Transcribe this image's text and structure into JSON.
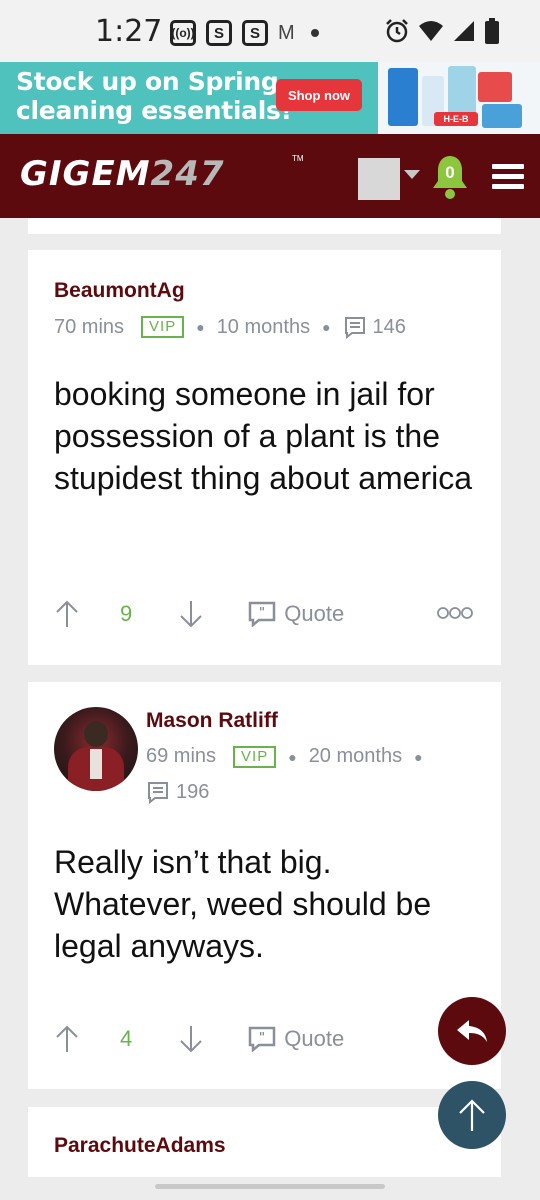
{
  "status_bar": {
    "time": "1:27",
    "icons": [
      "nfc-icon",
      "s-app-icon",
      "s-app-icon",
      "gmail-icon",
      "dot-icon",
      "alarm-icon",
      "wifi-icon",
      "signal-icon",
      "battery-icon"
    ],
    "s1": "S",
    "s2": "S",
    "m": "M"
  },
  "ad": {
    "headline_1": "Stock up on Spring",
    "headline_2": "cleaning essentials!",
    "button": "Shop now",
    "brand_color": "#4fc2bd",
    "button_color": "#e5363b",
    "image_brand": "H-E-B"
  },
  "header": {
    "logo_part_1": "GIGEM",
    "logo_part_2": "247",
    "tm": "TM",
    "notification_count": "0",
    "brand_color": "#5c0a0e"
  },
  "posts": [
    {
      "username": "BeaumontAg",
      "time": "70 mins",
      "badge": "VIP",
      "tenure": "10 months",
      "post_count": "146",
      "body": "booking someone in jail for possession of a plant is the stupidest thing about america",
      "upvotes": "9",
      "quote_label": "Quote"
    },
    {
      "username": "Mason Ratliff",
      "time": "69 mins",
      "badge": "VIP",
      "tenure": "20 months",
      "post_count": "196",
      "body": "Really isn’t that big. Whatever, weed should be legal anyways.",
      "upvotes": "4",
      "quote_label": "Quote"
    },
    {
      "username": "ParachuteAdams"
    }
  ]
}
